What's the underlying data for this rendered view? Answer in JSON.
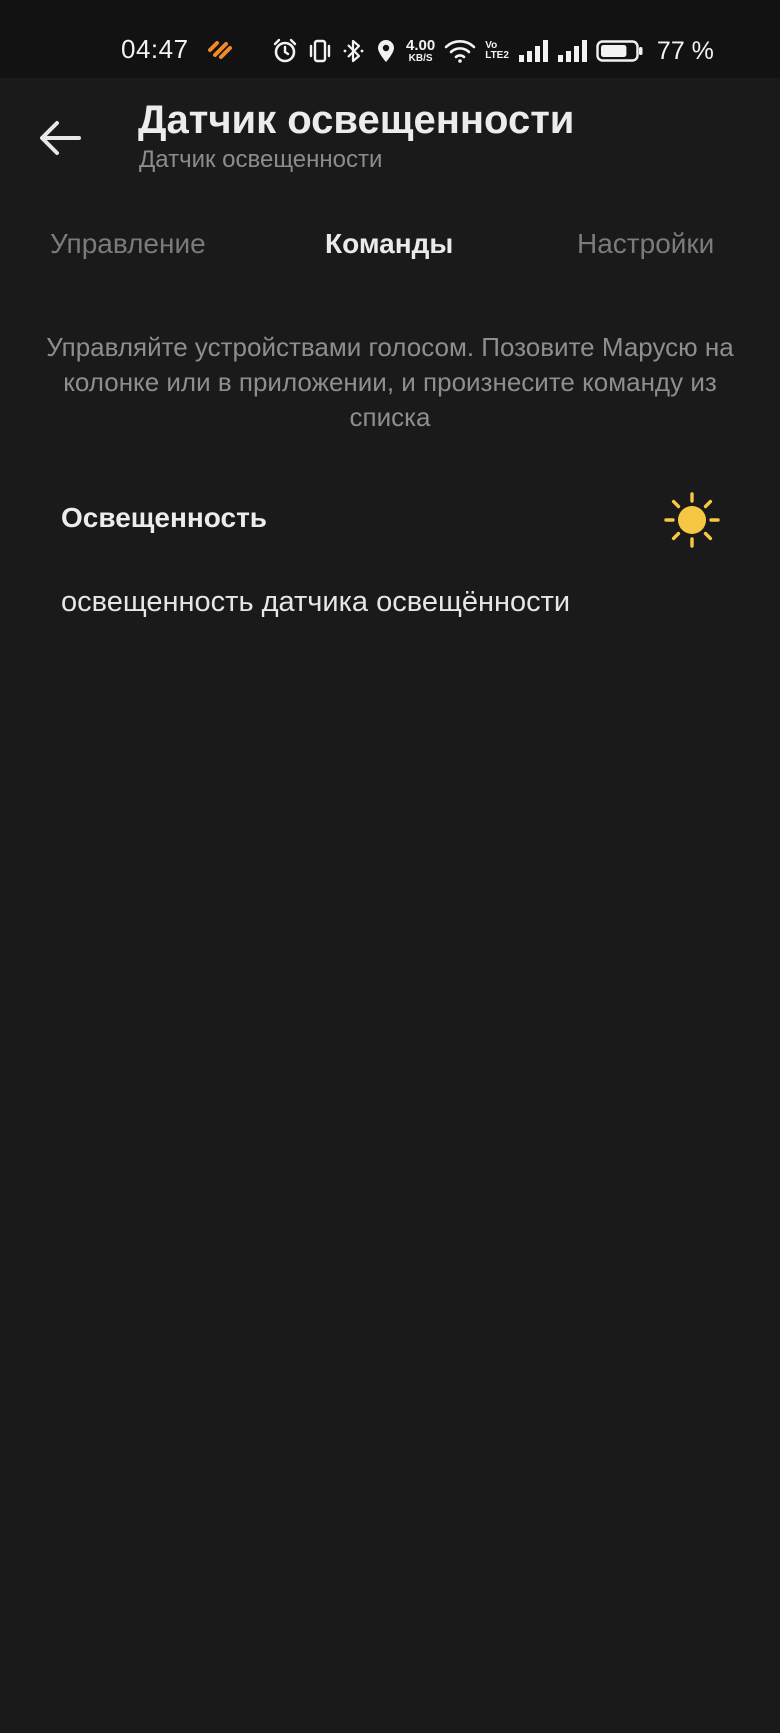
{
  "status_bar": {
    "time": "04:47",
    "net_speed_value": "4.00",
    "net_speed_unit": "KB/S",
    "volte_top": "Vo",
    "volte_bottom": "LTE2",
    "battery_percent": "77 %",
    "battery_level": 0.77
  },
  "header": {
    "title": "Датчик освещенности",
    "subtitle": "Датчик освещенности"
  },
  "tabs": [
    {
      "label": "Управление",
      "active": false
    },
    {
      "label": "Команды",
      "active": true
    },
    {
      "label": "Настройки",
      "active": false
    }
  ],
  "description": "Управляйте устройствами голосом. Позовите Марусю на колонке или в приложении, и произнесите команду из списка",
  "command": {
    "title": "Освещенность",
    "icon": "sun-icon",
    "phrase": "освещенность датчика освещённости"
  },
  "colors": {
    "background": "#1a1a1a",
    "accent_sun": "#f7c744",
    "app_icon": "#f08a2a"
  }
}
